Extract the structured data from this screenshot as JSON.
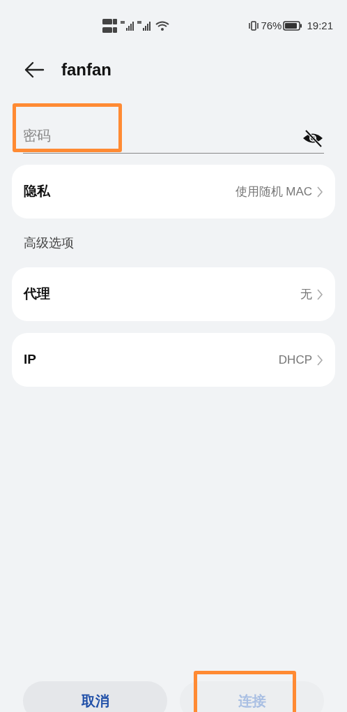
{
  "status_bar": {
    "battery": "76%",
    "time": "19:21"
  },
  "header": {
    "title": "fanfan"
  },
  "password": {
    "placeholder": "密码",
    "highlighted": true,
    "visible": false
  },
  "privacy": {
    "label": "隐私",
    "value": "使用随机 MAC"
  },
  "advanced": {
    "heading": "高级选项",
    "items": [
      {
        "label": "代理",
        "value": "无"
      },
      {
        "label": "IP",
        "value": "DHCP"
      }
    ]
  },
  "buttons": [
    {
      "label": "取消",
      "disabled": false,
      "highlighted": false
    },
    {
      "label": "连接",
      "disabled": true,
      "highlighted": true
    }
  ]
}
